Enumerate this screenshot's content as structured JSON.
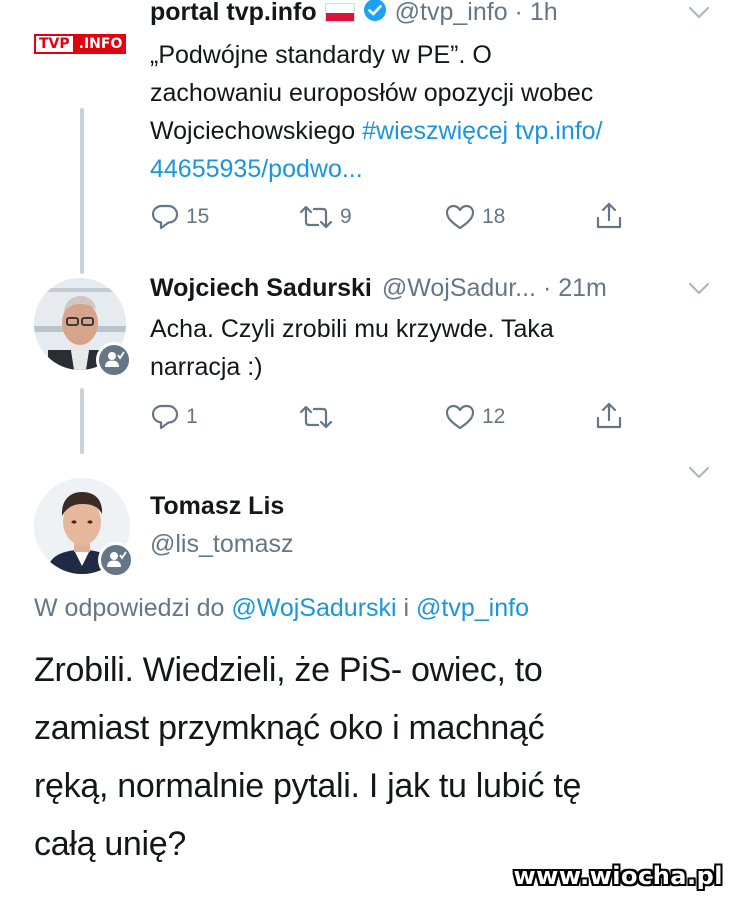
{
  "tweet1": {
    "logo_text_a": "TVP",
    "logo_text_b": ".INFO",
    "name": "portal tvp.info",
    "handle_time": "@tvp_info · 1h",
    "text_line1": "„Podwójne standardy w PE”. O",
    "text_line2": "zachowaniu europosłów opozycji wobec",
    "text_line3_plain": "Wojciechowskiego ",
    "text_line3_link": "#wieszwięcej tvp.info/",
    "text_line4_link": "44655935/podwo...",
    "replies": "15",
    "retweets": "9",
    "likes": "18"
  },
  "tweet2": {
    "name": "Wojciech Sadurski",
    "handle_time": "@WojSadur... · 21m",
    "text_line1": "Acha. Czyli zrobili mu krzywde. Taka",
    "text_line2": "narracja :)",
    "replies": "1",
    "retweets": "",
    "likes": "12"
  },
  "tweet3": {
    "name": "Tomasz Lis",
    "handle": "@lis_tomasz",
    "reply_prefix": "W odpowiedzi do ",
    "reply_user1": "@WojSadurski",
    "reply_and": " i ",
    "reply_user2": "@tvp_info",
    "text_line1": "Zrobili. Wiedzieli, że PiS- owiec, to",
    "text_line2": "zamiast przymknąć oko i machnąć",
    "text_line3": "ręką, normalnie pytali. I jak tu lubić tę",
    "text_line4": "całą unię?"
  },
  "watermark": "www.wiocha.pl",
  "colors": {
    "link": "#1b95e0",
    "secondary": "#657786",
    "verified": "#1da1f2",
    "tvp_red": "#e3000f"
  },
  "icons": [
    "reply-icon",
    "retweet-icon",
    "like-icon",
    "share-icon",
    "chevron-down-icon",
    "verified-icon",
    "flag-icon"
  ]
}
